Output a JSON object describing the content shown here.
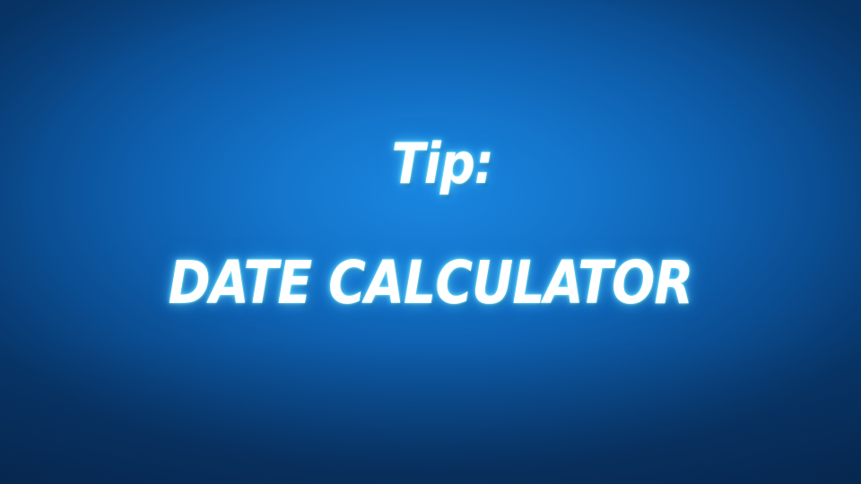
{
  "slide": {
    "tip_label": "Tip:",
    "title": "DATE CALCULATOR"
  },
  "colors": {
    "background_center": "#1a86e0",
    "background_edge": "#083b73",
    "text": "#ffffff",
    "glow": "#8ff3ff"
  }
}
